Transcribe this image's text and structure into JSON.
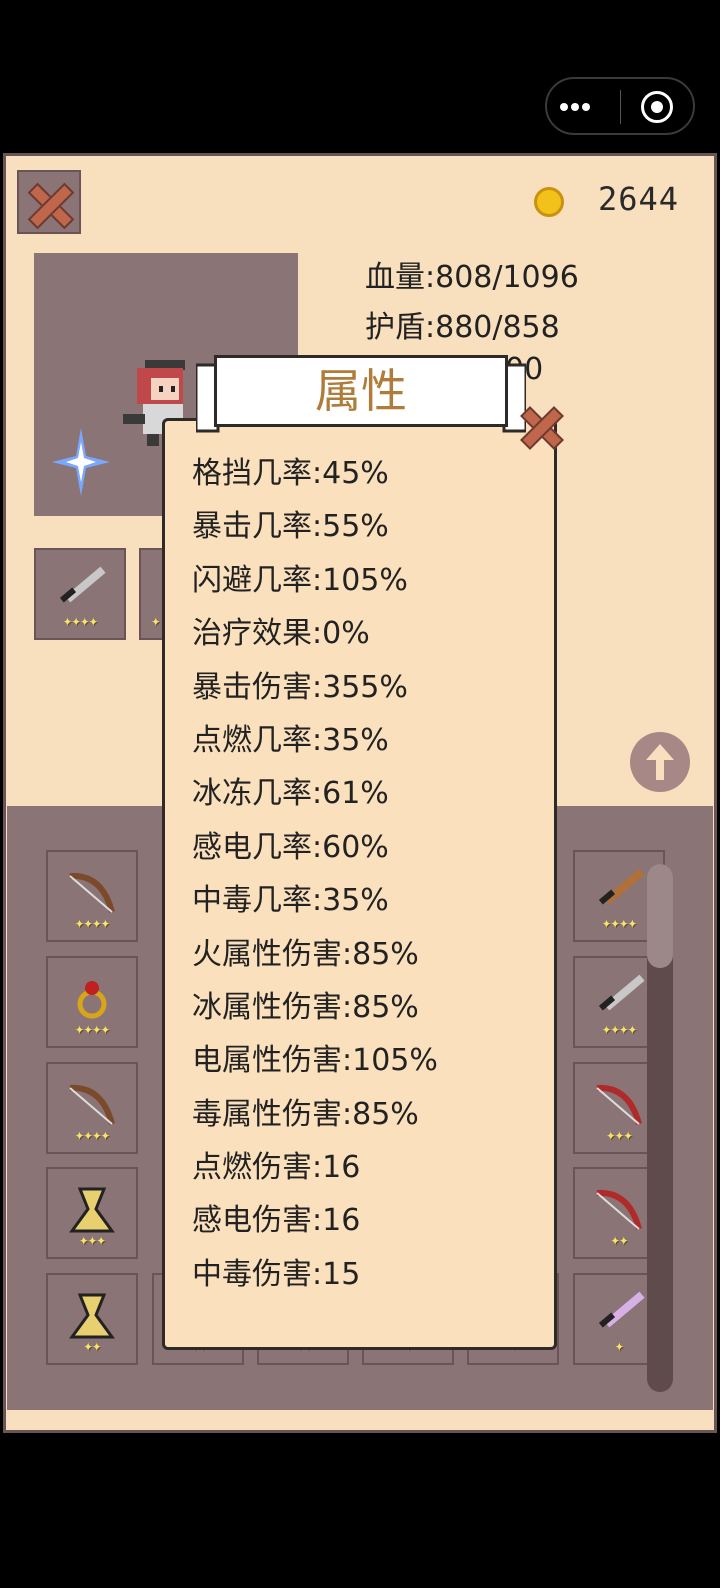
{
  "coins": "2644",
  "stats": {
    "hp": "血量:808/1096",
    "shield": "护盾:880/858",
    "partial": "00"
  },
  "popup": {
    "title": "属性",
    "attributes": [
      "格挡几率:45%",
      "暴击几率:55%",
      "闪避几率:105%",
      "治疗效果:0%",
      "暴击伤害:355%",
      "点燃几率:35%",
      "冰冻几率:61%",
      "感电几率:60%",
      "中毒几率:35%",
      "火属性伤害:85%",
      "冰属性伤害:85%",
      "电属性伤害:105%",
      "毒属性伤害:85%",
      "点燃伤害:16",
      "感电伤害:16",
      "中毒伤害:15"
    ]
  },
  "equipped": [
    {
      "icon": "sword-icon",
      "stars": "✦✦✦✦"
    },
    {
      "icon": "item-icon",
      "stars": "✦"
    }
  ],
  "inventory": {
    "left_column": [
      {
        "icon": "bow-icon",
        "stars": "✦✦✦✦"
      },
      {
        "icon": "ring-icon",
        "stars": "✦✦✦✦"
      },
      {
        "icon": "bow-icon",
        "stars": "✦✦✦✦"
      },
      {
        "icon": "armor-icon",
        "stars": "✦✦✦"
      },
      {
        "icon": "armor-icon",
        "stars": "✦✦"
      }
    ],
    "right_column": [
      {
        "icon": "wooden-sword-icon",
        "stars": "✦✦✦✦"
      },
      {
        "icon": "sword-icon",
        "stars": "✦✦✦✦"
      },
      {
        "icon": "red-bow-icon",
        "stars": "✦✦✦"
      },
      {
        "icon": "red-bow-icon",
        "stars": "✦✦"
      },
      {
        "icon": "purple-sword-icon",
        "stars": "✦"
      }
    ],
    "bottom_row_partial": [
      {
        "stars": "✦✦"
      },
      {
        "stars": "✦✦"
      },
      {
        "stars": "✦"
      },
      {
        "stars": "✦"
      }
    ]
  }
}
